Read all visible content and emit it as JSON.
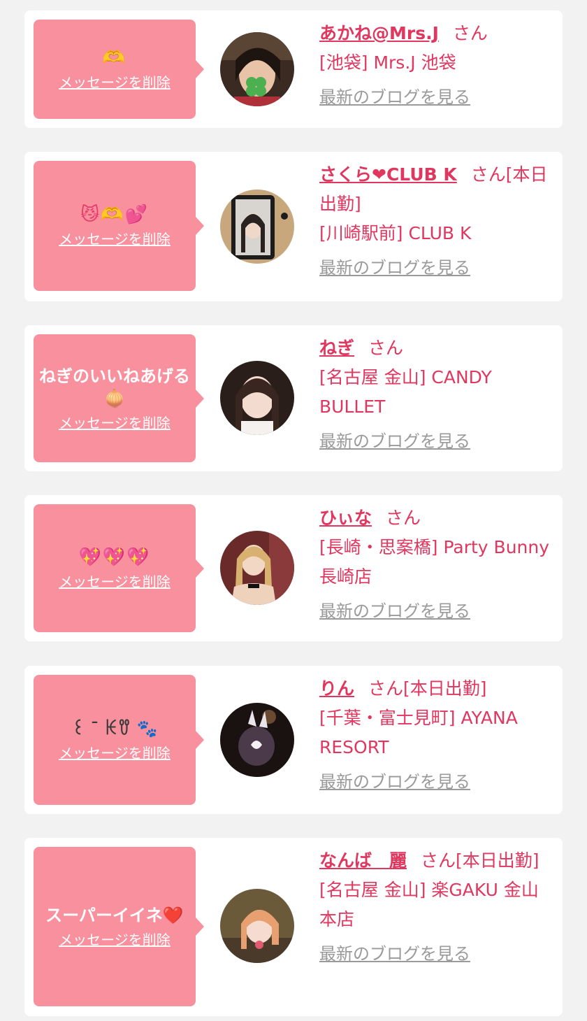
{
  "cards": [
    {
      "message": "🫶",
      "delete_label": "メッセージを削除",
      "name": "あかね@Mrs.J",
      "honorific": "さん",
      "shop": "[池袋] Mrs.J 池袋",
      "blog_label": "最新のブログを見る"
    },
    {
      "message": "😼🫶💕",
      "delete_label": "メッセージを削除",
      "name": "さくら❤CLUB K",
      "honorific": "さん[本日出勤]",
      "shop": "[川崎駅前] CLUB K",
      "blog_label": "最新のブログを見る"
    },
    {
      "message": "ねぎのいいねあげる🧅",
      "delete_label": "メッセージを削除",
      "name": "ねぎ",
      "honorific": "さん",
      "shop": "[名古屋 金山] CANDY BULLET",
      "blog_label": "最新のブログを見る"
    },
    {
      "message": "💖💖💖",
      "delete_label": "メッセージを削除",
      "name": "ひぃな",
      "honorific": "さん",
      "shop": "[長崎・思案橋] Party Bunny 長崎店",
      "blog_label": "最新のブログを見る"
    },
    {
      "message": "꒰ ¯ ꀘꀎ 🐾",
      "delete_label": "メッセージを削除",
      "name": "りん",
      "honorific": "さん[本日出勤]",
      "shop": "[千葉・富士見町] AYANA RESORT",
      "blog_label": "最新のブログを見る"
    },
    {
      "message": "スーパーイイネ❤️",
      "delete_label": "メッセージを削除",
      "name": "なんば　麗",
      "honorific": "さん[本日出勤]",
      "shop": "[名古屋 金山] 楽GAKU 金山本店",
      "blog_label": "最新のブログを見る"
    }
  ],
  "colors": {
    "page_bg": "#f2f2f2",
    "bubble": "#f8909e",
    "accent": "#e0375f",
    "link_gray": "#9a9a9a"
  }
}
